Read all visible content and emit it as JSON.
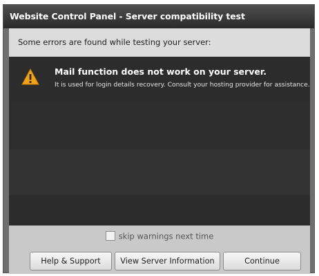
{
  "window": {
    "title": "Website Control Panel - Server compatibility test"
  },
  "header": {
    "message": "Some errors are found while testing your server:"
  },
  "errors": [
    {
      "icon": "warning-icon",
      "title": "Mail function does not work on your server.",
      "detail": "It is used for login details recovery. Consult your hosting provider for assistance."
    }
  ],
  "footer": {
    "skip_label": "skip warnings next time",
    "skip_checked": false,
    "buttons": {
      "help": "Help & Support",
      "view_info": "View Server Information",
      "continue": "Continue"
    }
  },
  "colors": {
    "titlebar": "#2f2f2f",
    "panel_dark": "#2c2c2c",
    "warning": "#f0a318"
  }
}
